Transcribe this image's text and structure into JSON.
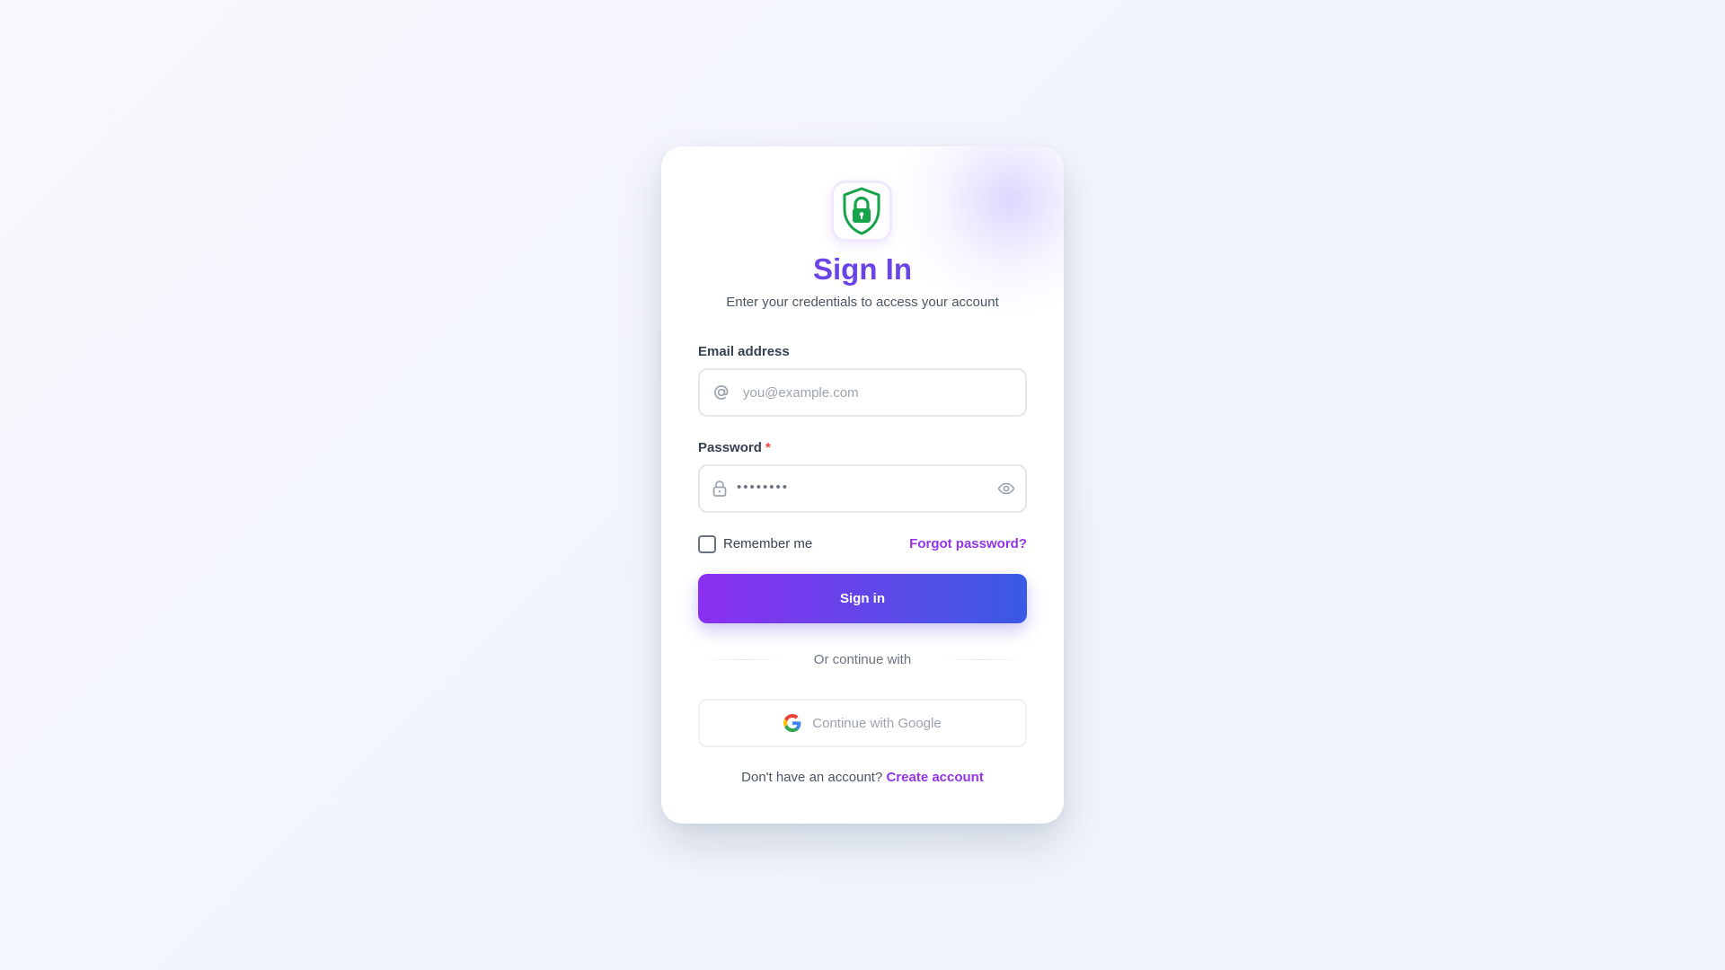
{
  "header": {
    "title": "Sign In",
    "subtitle": "Enter your credentials to access your account"
  },
  "email": {
    "label": "Email address",
    "placeholder": "you@example.com",
    "value": "",
    "icon": "at-sign-icon"
  },
  "password": {
    "label": "Password",
    "required_mark": "*",
    "masked_value": "••••••••",
    "icon": "lock-icon",
    "toggle_icon": "eye-icon"
  },
  "options": {
    "remember_label": "Remember me",
    "remember_checked": false,
    "forgot_label": "Forgot password?"
  },
  "actions": {
    "signin_label": "Sign in",
    "divider_text": "Or continue with",
    "google_label": "Continue with Google"
  },
  "footer": {
    "prompt": "Don't have an account?",
    "link_label": "Create account"
  },
  "colors": {
    "accent": "#6a44e6",
    "link": "#9333ea",
    "shield": "#16a34a",
    "button_gradient_start": "#8b2ff0",
    "button_gradient_end": "#3a5ae6",
    "required": "#ef4444"
  }
}
